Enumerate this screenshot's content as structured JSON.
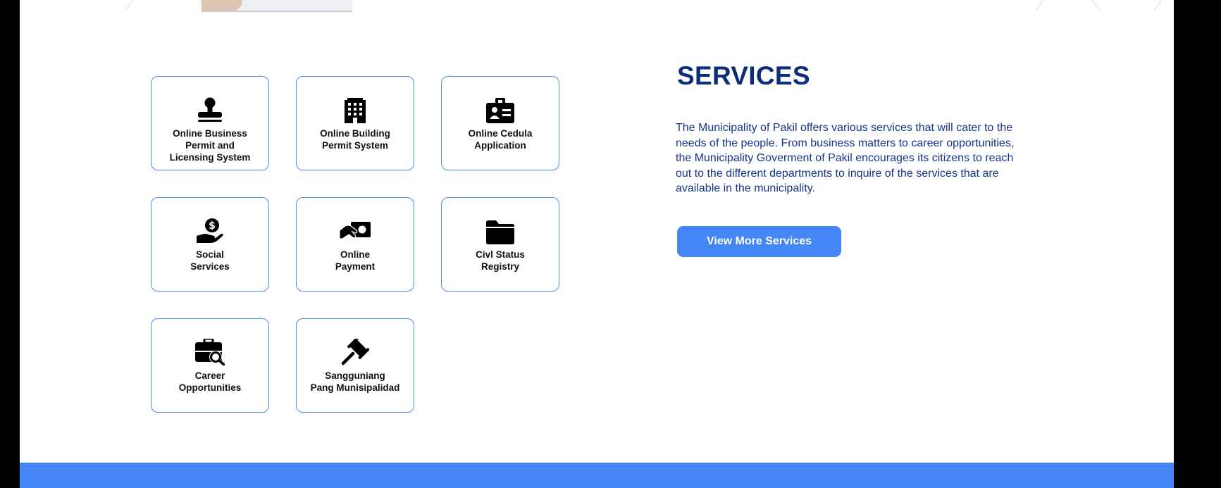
{
  "colors": {
    "accent": "#4386f5",
    "heading": "#0c2d7a",
    "body_text": "#14348a",
    "tile_border": "#4a8df4"
  },
  "services": {
    "title": "SERVICES",
    "description": "The Municipality of Pakil offers various services that will cater to the needs of the people. From business matters to career opportunities, the Municipality Goverment of Pakil encourages its citizens to reach out to the different departments to inquire of the services that are available in the municipality.",
    "button_label": "View More Services",
    "tiles": [
      {
        "label": "Online Business\nPermit and\nLicensing System",
        "icon": "stamp-icon"
      },
      {
        "label": "Online Building\nPermit System",
        "icon": "building-icon"
      },
      {
        "label": "Online Cedula\nApplication",
        "icon": "id-badge-icon"
      },
      {
        "label": "Social\nServices",
        "icon": "hand-holding-dollar-icon"
      },
      {
        "label": "Online\nPayment",
        "icon": "hand-money-icon"
      },
      {
        "label": "Civl Status\nRegistry",
        "icon": "folder-icon"
      },
      {
        "label": "Career\nOpportunities",
        "icon": "briefcase-search-icon"
      },
      {
        "label": "Sangguniang\nPang Munisipalidad",
        "icon": "gavel-icon"
      }
    ]
  }
}
